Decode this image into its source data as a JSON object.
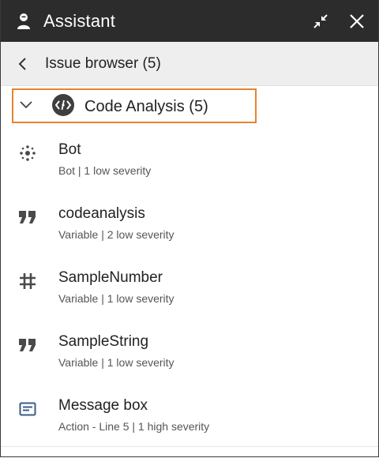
{
  "window": {
    "title": "Assistant"
  },
  "breadcrumb": {
    "label": "Issue browser (5)"
  },
  "group": {
    "label": "Code Analysis (5)",
    "highlight_color": "#e8822e"
  },
  "items": [
    {
      "name": "Bot",
      "detail": "Bot | 1 low severity",
      "icon": "bot-dots-icon"
    },
    {
      "name": "codeanalysis",
      "detail": "Variable | 2 low severity",
      "icon": "quote-icon"
    },
    {
      "name": "SampleNumber",
      "detail": "Variable | 1 low severity",
      "icon": "hash-icon"
    },
    {
      "name": "SampleString",
      "detail": "Variable | 1 low severity",
      "icon": "quote-icon"
    },
    {
      "name": "Message box",
      "detail": "Action - Line 5 | 1 high severity",
      "icon": "message-box-icon"
    }
  ],
  "colors": {
    "titlebar": "#2c2c2c",
    "breadcrumb_bg": "#eeeeee",
    "highlight": "#e8822e",
    "icon": "#4a4a4a"
  }
}
